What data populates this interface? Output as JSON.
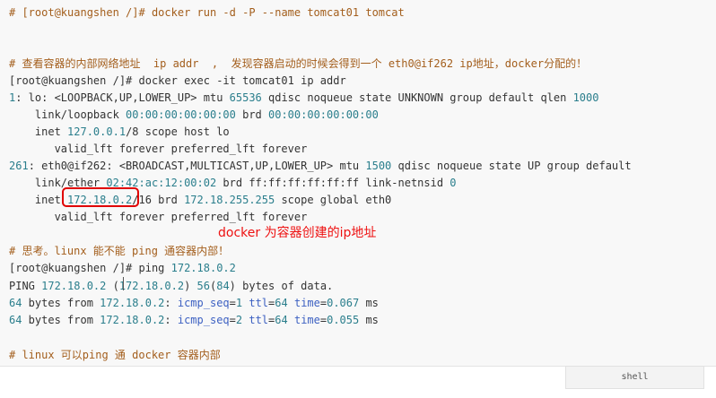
{
  "code_lines": [
    {
      "parts": [
        {
          "text": "# ",
          "cls": "c"
        },
        {
          "text": "[root@kuangshen /]# docker run -d -P --name tomcat01 tomcat",
          "cls": "c"
        }
      ]
    },
    {
      "parts": [
        {
          "text": "# 查看容器的内部网络地址  ip addr  ,  发现容器启动的时候会得到一个 eth0@if262 ip地址，docker分配的！",
          "cls": "c"
        }
      ]
    },
    {
      "parts": [
        {
          "text": "[root@kuangshen /]# docker exec -it tomcat01 ip addr",
          "cls": ""
        }
      ]
    },
    {
      "parts": [
        {
          "text": "1",
          "cls": "n"
        },
        {
          "text": ": lo: <LOOPBACK,UP,LOWER_UP> mtu ",
          "cls": ""
        },
        {
          "text": "65536",
          "cls": "n"
        },
        {
          "text": " qdisc noqueue state UNKNOWN group default qlen ",
          "cls": ""
        },
        {
          "text": "1000",
          "cls": "n"
        }
      ]
    },
    {
      "parts": [
        {
          "text": "    link/loopback ",
          "cls": ""
        },
        {
          "text": "00:00:00:00:00:00",
          "cls": "n"
        },
        {
          "text": " brd ",
          "cls": ""
        },
        {
          "text": "00:00:00:00:00:00",
          "cls": "n"
        }
      ]
    },
    {
      "parts": [
        {
          "text": "    inet ",
          "cls": ""
        },
        {
          "text": "127.0.0.1",
          "cls": "n"
        },
        {
          "text": "/8 scope host lo",
          "cls": ""
        }
      ]
    },
    {
      "parts": [
        {
          "text": "       valid_lft forever preferred_lft forever",
          "cls": ""
        }
      ]
    },
    {
      "parts": [
        {
          "text": "261",
          "cls": "n"
        },
        {
          "text": ": eth0@if262: <BROADCAST,MULTICAST,UP,LOWER_UP> mtu ",
          "cls": ""
        },
        {
          "text": "1500",
          "cls": "n"
        },
        {
          "text": " qdisc noqueue state UP group default",
          "cls": ""
        }
      ]
    },
    {
      "parts": [
        {
          "text": "    link/ether ",
          "cls": ""
        },
        {
          "text": "02:42:ac:12:00:02",
          "cls": "n"
        },
        {
          "text": " brd ff:ff:ff:ff:ff:ff link-netnsid ",
          "cls": ""
        },
        {
          "text": "0",
          "cls": "n"
        }
      ]
    },
    {
      "parts": [
        {
          "text": "    inet ",
          "cls": ""
        },
        {
          "text": "172.18.0.2",
          "cls": "n"
        },
        {
          "text": "/16 brd ",
          "cls": ""
        },
        {
          "text": "172.18.255.255",
          "cls": "n"
        },
        {
          "text": " scope global eth0",
          "cls": ""
        }
      ]
    },
    {
      "parts": [
        {
          "text": "       valid_lft forever preferred_lft forever",
          "cls": ""
        }
      ]
    },
    {
      "parts": [
        {
          "text": "# 思考。liunx 能不能 ping 通容器内部！",
          "cls": "c"
        }
      ]
    },
    {
      "parts": [
        {
          "text": "[root@kuangshen /]# ping ",
          "cls": ""
        },
        {
          "text": "172.18.0.2",
          "cls": "n"
        }
      ]
    },
    {
      "parts": [
        {
          "text": "PING ",
          "cls": ""
        },
        {
          "text": "172.18.0.2",
          "cls": "n"
        },
        {
          "text": " (",
          "cls": ""
        },
        {
          "text": "172.18.0.2",
          "cls": "n"
        },
        {
          "text": ") ",
          "cls": ""
        },
        {
          "text": "56",
          "cls": "n"
        },
        {
          "text": "(",
          "cls": ""
        },
        {
          "text": "84",
          "cls": "n"
        },
        {
          "text": ") bytes of data.",
          "cls": ""
        }
      ]
    },
    {
      "parts": [
        {
          "text": "64",
          "cls": "n"
        },
        {
          "text": " bytes from ",
          "cls": ""
        },
        {
          "text": "172.18.0.2",
          "cls": "n"
        },
        {
          "text": ": ",
          "cls": ""
        },
        {
          "text": "icmp_seq",
          "cls": "k"
        },
        {
          "text": "=",
          "cls": ""
        },
        {
          "text": "1",
          "cls": "n"
        },
        {
          "text": " ",
          "cls": ""
        },
        {
          "text": "ttl",
          "cls": "k"
        },
        {
          "text": "=",
          "cls": ""
        },
        {
          "text": "64",
          "cls": "n"
        },
        {
          "text": " ",
          "cls": ""
        },
        {
          "text": "time",
          "cls": "k"
        },
        {
          "text": "=",
          "cls": ""
        },
        {
          "text": "0.067",
          "cls": "n"
        },
        {
          "text": " ms",
          "cls": ""
        }
      ]
    },
    {
      "parts": [
        {
          "text": "64",
          "cls": "n"
        },
        {
          "text": " bytes from ",
          "cls": ""
        },
        {
          "text": "172.18.0.2",
          "cls": "n"
        },
        {
          "text": ": ",
          "cls": ""
        },
        {
          "text": "icmp_seq",
          "cls": "k"
        },
        {
          "text": "=",
          "cls": ""
        },
        {
          "text": "2",
          "cls": "n"
        },
        {
          "text": " ",
          "cls": ""
        },
        {
          "text": "ttl",
          "cls": "k"
        },
        {
          "text": "=",
          "cls": ""
        },
        {
          "text": "64",
          "cls": "n"
        },
        {
          "text": " ",
          "cls": ""
        },
        {
          "text": "time",
          "cls": "k"
        },
        {
          "text": "=",
          "cls": ""
        },
        {
          "text": "0.055",
          "cls": "n"
        },
        {
          "text": " ms",
          "cls": ""
        }
      ]
    },
    {
      "parts": [
        {
          "text": "# linux 可以ping 通 docker 容器内部",
          "cls": "c"
        }
      ]
    }
  ],
  "annotation": {
    "text": "docker 为容器创建的ip地址",
    "color": "#ee1111"
  },
  "footer": {
    "language_label": "shell"
  },
  "colors": {
    "comment": "#a35e1c",
    "number": "#2a7e8c",
    "keyword": "#3d61c2",
    "text": "#333333"
  }
}
